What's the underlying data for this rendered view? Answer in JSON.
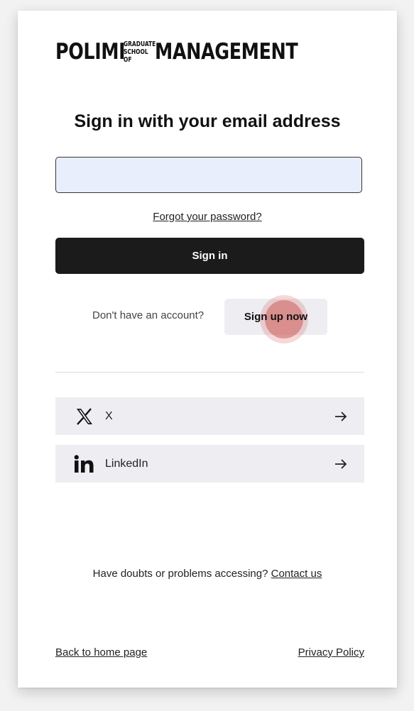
{
  "logo": {
    "polimi": "POLIMI",
    "graduate": "GRADUATE",
    "school_of": "SCHOOL OF",
    "management": "MANAGEMENT"
  },
  "form": {
    "title": "Sign in with your email address",
    "email_value": "",
    "forgot_password": "Forgot your password?",
    "sign_in_label": "Sign in"
  },
  "signup": {
    "prompt": "Don't have an account?",
    "button_label": "Sign up now"
  },
  "social": [
    {
      "label": "X",
      "icon": "x-logo-icon"
    },
    {
      "label": "LinkedIn",
      "icon": "linkedin-logo-icon"
    }
  ],
  "help": {
    "text": "Have doubts or problems accessing?",
    "contact_link": "Contact us"
  },
  "footer": {
    "back_link": "Back to home page",
    "privacy_link": "Privacy Policy"
  },
  "colors": {
    "primary_button": "#1b1b1b",
    "input_background": "#e8eefc",
    "secondary_button": "#eeeef2"
  }
}
